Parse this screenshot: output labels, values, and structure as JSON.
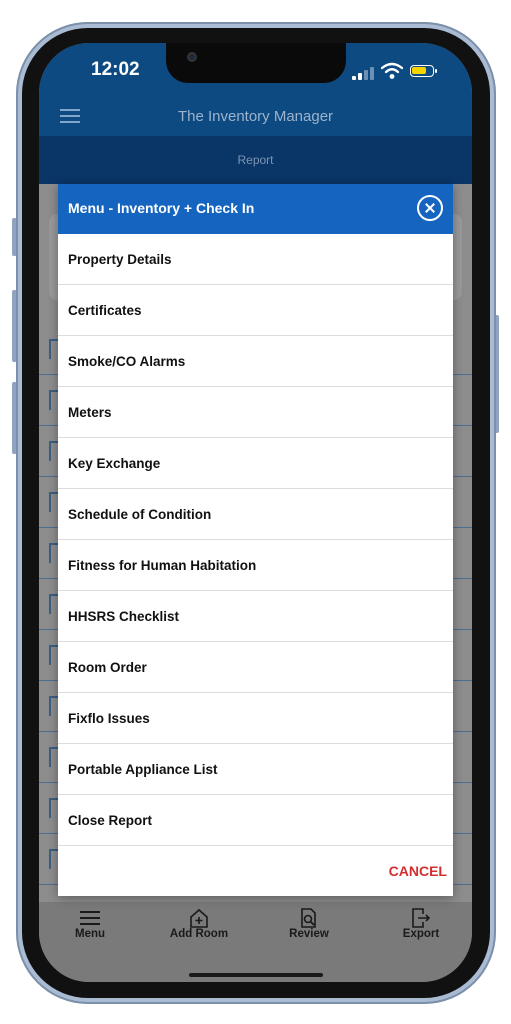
{
  "status_bar": {
    "time": "12:02"
  },
  "app_bar": {
    "title": "The Inventory Manager",
    "subtitle": "Report"
  },
  "modal": {
    "title": "Menu - Inventory + Check In",
    "items": [
      {
        "label": "Property Details"
      },
      {
        "label": "Certificates"
      },
      {
        "label": "Smoke/CO Alarms"
      },
      {
        "label": "Meters"
      },
      {
        "label": "Key Exchange"
      },
      {
        "label": "Schedule of Condition"
      },
      {
        "label": "Fitness for Human Habitation"
      },
      {
        "label": "HHSRS Checklist"
      },
      {
        "label": "Room Order"
      },
      {
        "label": "Fixflo Issues"
      },
      {
        "label": "Portable Appliance List"
      },
      {
        "label": "Close Report"
      }
    ],
    "cancel_label": "CANCEL"
  },
  "tab_bar": {
    "menu_label": "Menu",
    "add_room_label": "Add Room",
    "review_label": "Review",
    "export_label": "Export"
  },
  "colors": {
    "app_bar": "#0e4a82",
    "sub_bar": "#0a3567",
    "modal_header": "#1565c0",
    "cancel": "#d32f2f",
    "battery": "#f6d400"
  }
}
